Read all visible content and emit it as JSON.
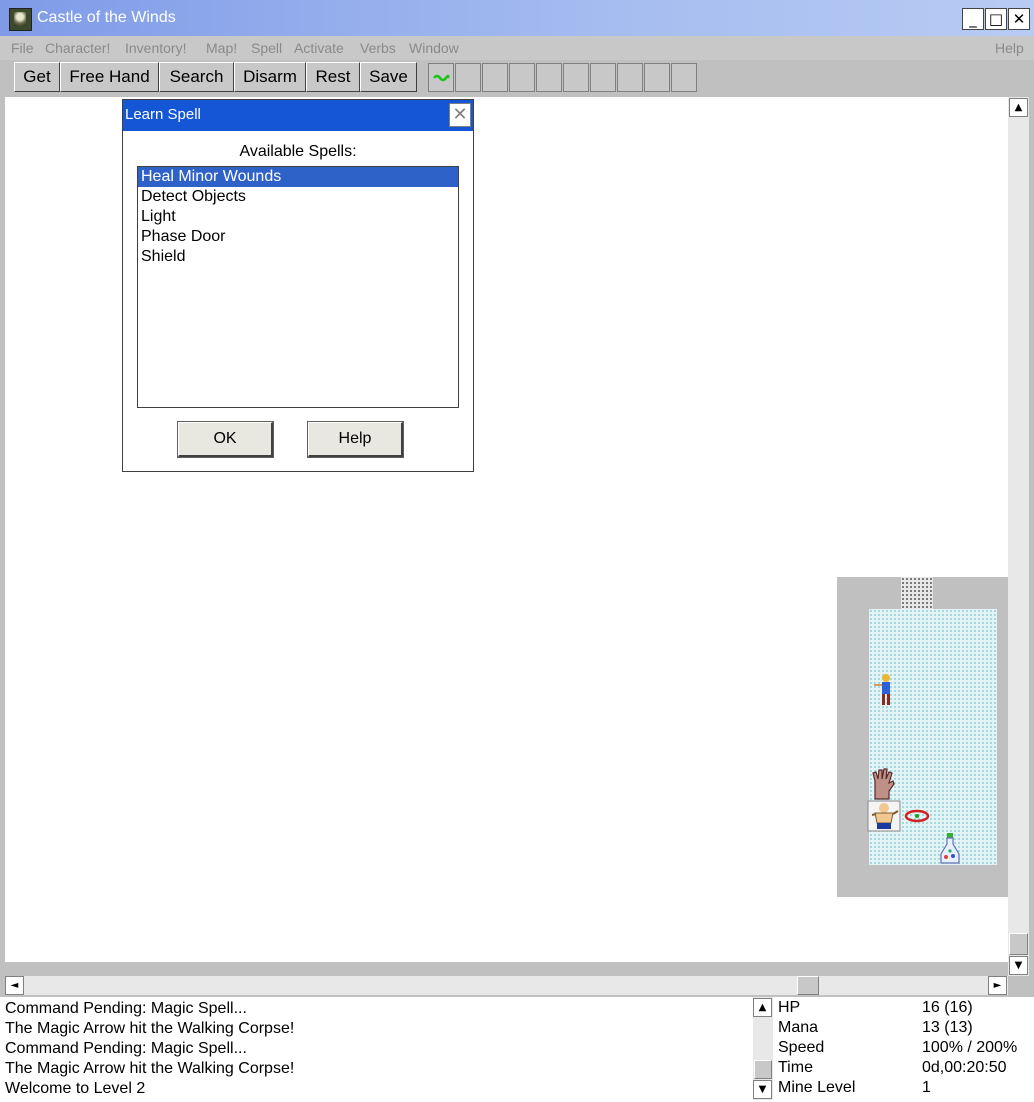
{
  "window": {
    "title": "Castle of the Winds",
    "minimize": "_",
    "maximize": "□",
    "close": "✕"
  },
  "menu": [
    "File",
    "Character!",
    "Inventory!",
    "Map!",
    "Spell",
    "Activate",
    "Verbs",
    "Window",
    "Help"
  ],
  "toolbar": {
    "buttons": [
      "Get",
      "Free Hand",
      "Search",
      "Disarm",
      "Rest",
      "Save"
    ],
    "slot_count": 10
  },
  "dialog": {
    "title": "Learn Spell",
    "close": "✕",
    "label": "Available Spells:",
    "spells": [
      "Heal Minor Wounds",
      "Detect Objects",
      "Light",
      "Phase Door",
      "Shield"
    ],
    "selected_index": 0,
    "ok_label": "OK",
    "help_label": "Help"
  },
  "messages": [
    "Command Pending: Magic Spell...",
    "The Magic Arrow hit the Walking Corpse!",
    "Command Pending: Magic Spell...",
    "The Magic Arrow hit the Walking Corpse!",
    "Welcome to Level 2"
  ],
  "stats": [
    {
      "label": "HP",
      "value": "16 (16)"
    },
    {
      "label": "Mana",
      "value": "13 (13)"
    },
    {
      "label": "Speed",
      "value": "100% / 200%"
    },
    {
      "label": "Time",
      "value": "0d,00:20:50"
    },
    {
      "label": "Mine Level",
      "value": "1"
    }
  ],
  "scroll": {
    "up": "▲",
    "down": "▼",
    "left": "◄",
    "right": "►"
  },
  "map_entities": [
    "walking-corpse-sprite",
    "severed-hand-sprite",
    "player-sprite",
    "ring-item",
    "potion-item"
  ]
}
